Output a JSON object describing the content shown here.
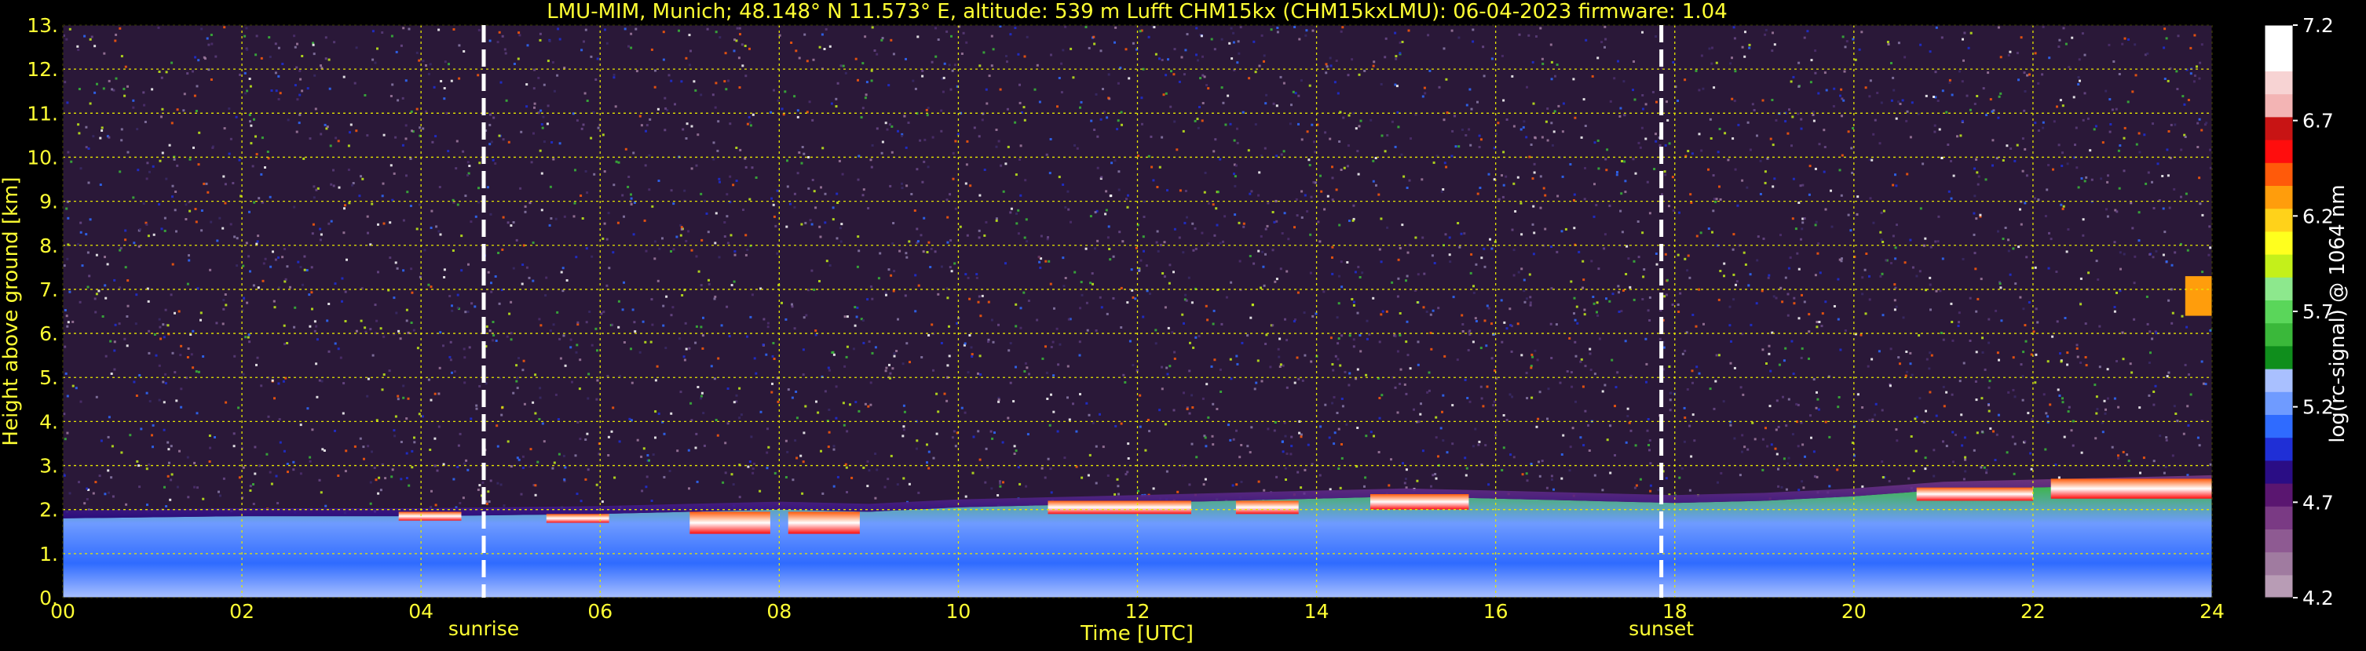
{
  "chart_data": {
    "type": "heatmap",
    "title": "LMU-MIM, Munich; 48.148° N 11.573° E, altitude: 539 m    Lufft CHM15kx (CHM15kxLMU): 06-04-2023    firmware: 1.04",
    "xlabel": "Time [UTC]",
    "ylabel": "Height above ground [km]",
    "xlim": [
      0,
      24
    ],
    "ylim": [
      0,
      13
    ],
    "x_ticks": [
      "00",
      "02",
      "04",
      "06",
      "08",
      "10",
      "12",
      "14",
      "16",
      "18",
      "20",
      "22",
      "24"
    ],
    "y_ticks": [
      "0.",
      "1.",
      "2.",
      "3.",
      "4.",
      "5.",
      "6.",
      "7.",
      "8.",
      "9.",
      "10.",
      "11.",
      "12.",
      "13."
    ],
    "grid": true,
    "colorbar": {
      "label": "log(rc-signal) @ 1064 nm",
      "ticks": [
        "4.2",
        "4.7",
        "5.2",
        "5.7",
        "6.2",
        "6.7",
        "7.2"
      ],
      "range": [
        4.2,
        7.2
      ],
      "colors": [
        "#b89cb5",
        "#a07ba0",
        "#8e5a92",
        "#7a3a84",
        "#5a1670",
        "#2a0d85",
        "#1f2fd6",
        "#2f6bff",
        "#6f9bff",
        "#a9c0ff",
        "#0f8e1c",
        "#3ab83a",
        "#5ad65a",
        "#8de88d",
        "#c4f01a",
        "#ffff1e",
        "#ffd21a",
        "#ff9d0c",
        "#ff5a0a",
        "#ff0d0d",
        "#c81414",
        "#f3b4b4",
        "#f7d3d3",
        "#ffffff",
        "#ffffff"
      ]
    },
    "annotations": [
      {
        "label": "sunrise",
        "x": 4.7
      },
      {
        "label": "sunset",
        "x": 17.85
      }
    ],
    "boundary_layer_top_km": [
      [
        0,
        1.8
      ],
      [
        2,
        1.85
      ],
      [
        4,
        1.85
      ],
      [
        6,
        1.9
      ],
      [
        7,
        1.95
      ],
      [
        8,
        2.0
      ],
      [
        9,
        1.95
      ],
      [
        10,
        2.05
      ],
      [
        11,
        2.1
      ],
      [
        12,
        2.15
      ],
      [
        13,
        2.2
      ],
      [
        14,
        2.25
      ],
      [
        15,
        2.3
      ],
      [
        16,
        2.25
      ],
      [
        17,
        2.2
      ],
      [
        18,
        2.15
      ],
      [
        19,
        2.2
      ],
      [
        20,
        2.3
      ],
      [
        21,
        2.45
      ],
      [
        22,
        2.5
      ],
      [
        23,
        2.55
      ],
      [
        24,
        2.6
      ]
    ],
    "cloud_layers": [
      {
        "x": [
          3.75,
          4.45
        ],
        "y": [
          1.75,
          1.95
        ]
      },
      {
        "x": [
          5.4,
          6.1
        ],
        "y": [
          1.7,
          1.9
        ]
      },
      {
        "x": [
          7.0,
          7.9
        ],
        "y": [
          1.45,
          1.95
        ]
      },
      {
        "x": [
          8.1,
          8.9
        ],
        "y": [
          1.45,
          1.95
        ]
      },
      {
        "x": [
          11.0,
          12.6
        ],
        "y": [
          1.9,
          2.2
        ]
      },
      {
        "x": [
          13.1,
          13.8
        ],
        "y": [
          1.9,
          2.2
        ]
      },
      {
        "x": [
          14.6,
          15.7
        ],
        "y": [
          2.0,
          2.35
        ]
      },
      {
        "x": [
          20.7,
          22.0
        ],
        "y": [
          2.2,
          2.5
        ]
      },
      {
        "x": [
          22.2,
          24.0
        ],
        "y": [
          2.25,
          2.7
        ]
      }
    ],
    "elevated_layer": {
      "x": [
        23.7,
        24.0
      ],
      "y": [
        6.4,
        7.3
      ]
    }
  }
}
